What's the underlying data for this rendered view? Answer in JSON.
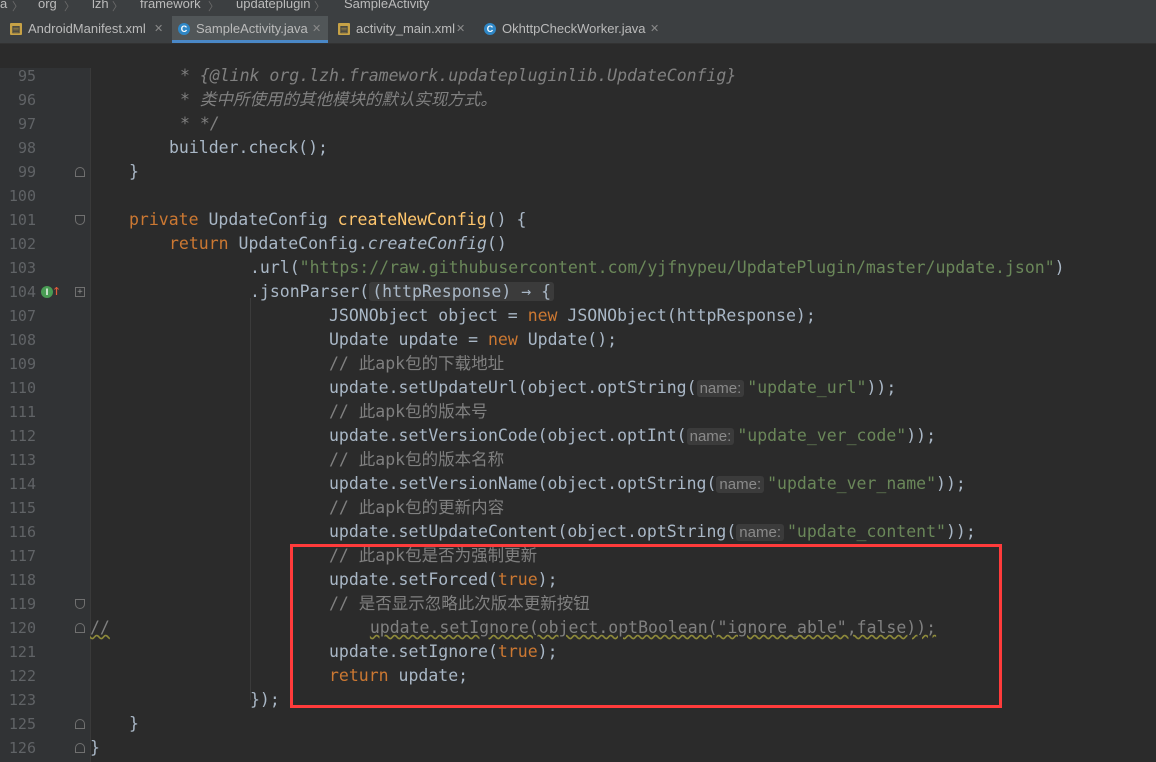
{
  "breadcrumb": [
    "a",
    "org",
    "lzh",
    "framework",
    "updateplugin",
    "SampleActivity"
  ],
  "tabs": [
    {
      "label": "AndroidManifest.xml",
      "icon": "xml-file-icon"
    },
    {
      "label": "SampleActivity.java",
      "icon": "class-file-icon",
      "active": true
    },
    {
      "label": "activity_main.xml",
      "icon": "xml-file-icon"
    },
    {
      "label": "OkhttpCheckWorker.java",
      "icon": "class-file-icon"
    }
  ],
  "code": {
    "l95": "* {@link org.lzh.framework.updatepluginlib.UpdateConfig}",
    "l96": "* 类中所使用的其他模块的默认实现方式。",
    "l97": "* */",
    "l98": "builder.check();",
    "l99": "}",
    "l101a": "private",
    "l101b": "UpdateConfig",
    "l101c": "createNewConfig",
    "l101d": "() {",
    "l102a": "return",
    "l102b": "UpdateConfig.",
    "l102c": "createConfig",
    "l102d": "()",
    "l103a": ".url(",
    "l103b": "\"https://raw.githubusercontent.com/yjfnypeu/UpdatePlugin/master/update.json\"",
    "l103c": ")",
    "l104a": ".jsonParser(",
    "l104b": "(httpResponse) → {",
    "l107a": "JSONObject object = ",
    "l107b": "new",
    "l107c": " JSONObject(httpResponse);",
    "l108a": "Update update = ",
    "l108b": "new",
    "l108c": " Update();",
    "l109": "// 此apk包的下载地址",
    "l110a": "update.setUpdateUrl(object.optString(",
    "l110h": "name:",
    "l110b": "\"update_url\"",
    "l110c": "));",
    "l111": "// 此apk包的版本号",
    "l112a": "update.setVersionCode(object.optInt(",
    "l112h": "name:",
    "l112b": "\"update_ver_code\"",
    "l112c": "));",
    "l113": "// 此apk包的版本名称",
    "l114a": "update.setVersionName(object.optString(",
    "l114h": "name:",
    "l114b": "\"update_ver_name\"",
    "l114c": "));",
    "l115": "// 此apk包的更新内容",
    "l116a": "update.setUpdateContent(object.optString(",
    "l116h": "name:",
    "l116b": "\"update_content\"",
    "l116c": "));",
    "l117": "// 此apk包是否为强制更新",
    "l118a": "update.setForced(",
    "l118b": "true",
    "l118c": ");",
    "l119": "// 是否显示忽略此次版本更新按钮",
    "l120a": "//",
    "l120b": "update.setIgnore(object.optBoolean(\"ignore_able\",false));",
    "l121a": "update.setIgnore(",
    "l121b": "true",
    "l121c": ");",
    "l122a": "return",
    "l122b": " update;",
    "l123": "});",
    "l125": "}",
    "l126": "}"
  },
  "line_numbers": [
    "95",
    "96",
    "97",
    "98",
    "99",
    "100",
    "101",
    "102",
    "103",
    "104",
    "107",
    "108",
    "109",
    "110",
    "111",
    "112",
    "113",
    "114",
    "115",
    "116",
    "117",
    "118",
    "119",
    "120",
    "121",
    "122",
    "123",
    "125",
    "126"
  ],
  "highlight_color": "#ff3b3b"
}
